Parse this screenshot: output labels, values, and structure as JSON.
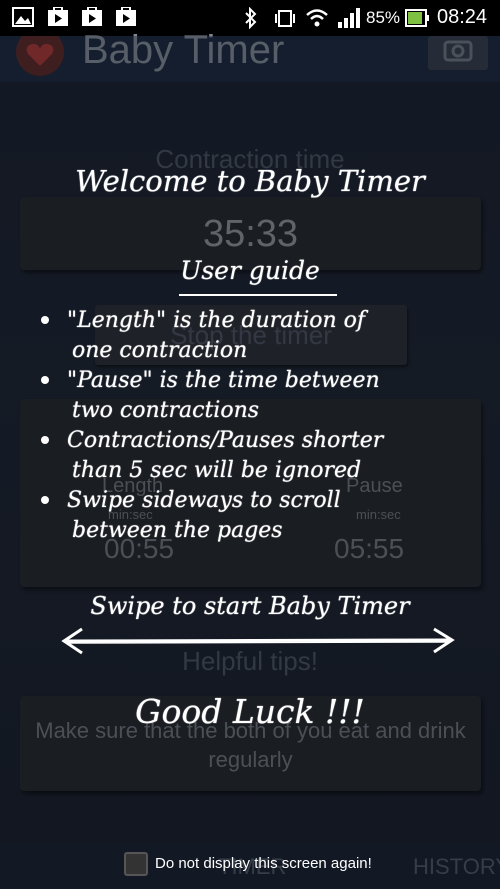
{
  "status_bar": {
    "battery_percent": "85%",
    "time": "08:24",
    "icons": [
      "gallery-icon",
      "play-store-icon",
      "play-store-icon",
      "play-store-icon",
      "bluetooth-icon",
      "vibrate-icon",
      "wifi-icon",
      "signal-icon",
      "battery-icon"
    ]
  },
  "app": {
    "title": "Baby Timer",
    "contraction_section_title": "Contraction time",
    "timer_value": "35:33",
    "stop_button_label": "Stop the timer",
    "length_label": "Length",
    "length_unit": "min:sec",
    "length_value": "00:55",
    "pause_label": "Pause",
    "pause_unit": "min:sec",
    "pause_value": "05:55",
    "tips_title": "Helpful tips!",
    "tip_text": "Make sure that the both of you eat and drink regularly",
    "tabs": [
      "TIMER",
      "HISTORY"
    ]
  },
  "overlay": {
    "welcome": "Welcome to Baby Timer",
    "guide_title": "User guide",
    "bullets": [
      [
        "\"Length\" is the duration of",
        "one contraction"
      ],
      [
        "\"Pause\" is the time between",
        "two contractions"
      ],
      [
        "Contractions/Pauses shorter",
        "than 5 sec will be ignored"
      ],
      [
        "Swipe sideways to scroll",
        "between the pages"
      ]
    ],
    "swipe_hint": "Swipe to start Baby Timer",
    "good_luck": "Good Luck !!!",
    "dont_show_label": "Do not display this screen again!",
    "dont_show_checked": false
  },
  "colors": {
    "background": "#1f2736",
    "card": "#262a31",
    "battery_fill": "#7ec142",
    "overlay_text": "#ffffff"
  }
}
